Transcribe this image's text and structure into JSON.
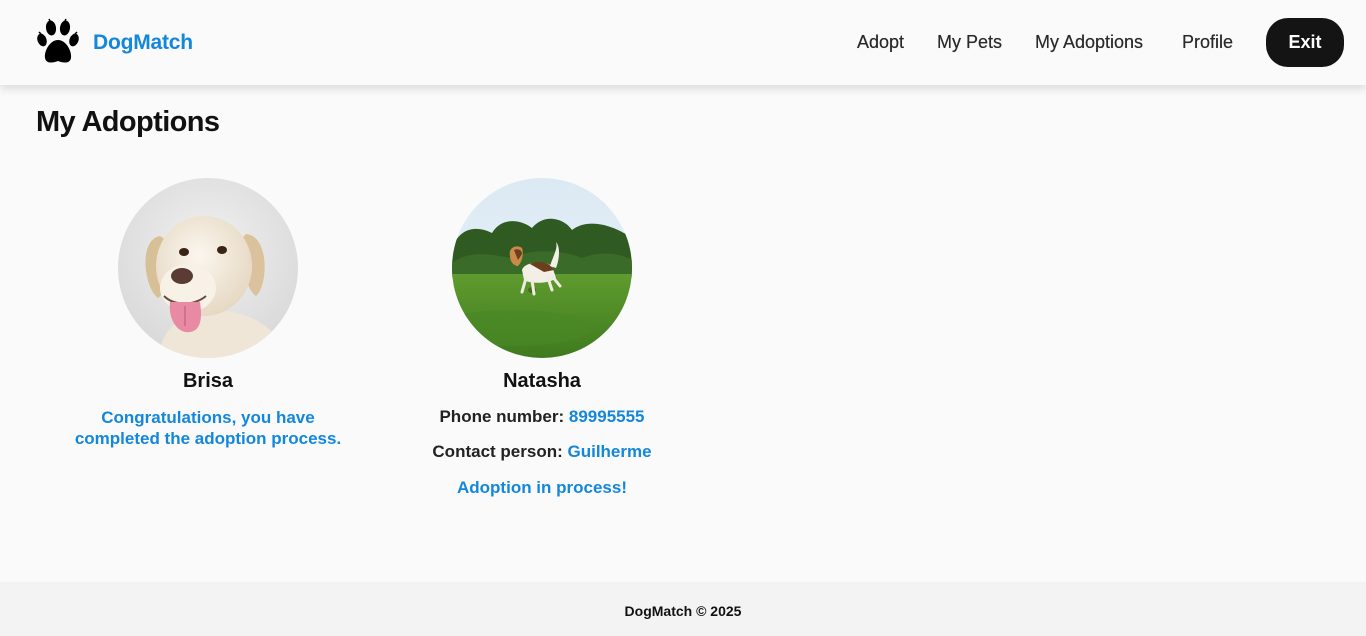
{
  "brand": {
    "name": "DogMatch",
    "logo_icon": "paw-icon"
  },
  "nav": {
    "links": [
      "Adopt",
      "My Pets",
      "My Adoptions",
      "Profile"
    ],
    "exit_label": "Exit"
  },
  "page": {
    "title": "My Adoptions"
  },
  "adoptions": [
    {
      "name": "Brisa",
      "photo": "labrador-photo",
      "status": "Congratulations, you have completed the adoption process."
    },
    {
      "name": "Natasha",
      "photo": "beagle-photo",
      "phone_label": "Phone number:",
      "phone": "89995555",
      "contact_label": "Contact person:",
      "contact": "Guilherme",
      "status": "Adoption in process!"
    }
  ],
  "footer": {
    "text": "DogMatch © 2025"
  },
  "colors": {
    "accent": "#1387dc",
    "button_bg": "#141414",
    "page_bg": "#fafafa"
  }
}
